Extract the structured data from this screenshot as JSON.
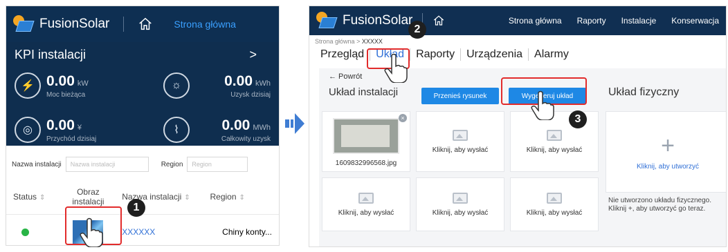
{
  "left": {
    "logo": "FusionSolar",
    "home_link": "Strona główna",
    "kpi_title": "KPI instalacji",
    "kpi_chevron": ">",
    "kpis": [
      {
        "value": "0.00",
        "unit": "kW",
        "label": "Moc bieżąca",
        "icon": "lightning-icon"
      },
      {
        "value": "0.00",
        "unit": "kWh",
        "label": "Uzysk dzisiaj",
        "icon": "sun-gear-icon"
      },
      {
        "value": "0.00",
        "unit": "¥",
        "label": "Przychód dzisiaj",
        "icon": "coins-icon"
      },
      {
        "value": "0.00",
        "unit": "MWh",
        "label": "Całkowity uzysk",
        "icon": "chart-icon"
      }
    ],
    "filter": {
      "name_label": "Nazwa instalacji",
      "name_placeholder": "Nazwa instalacji",
      "region_label": "Region",
      "region_placeholder": "Region"
    },
    "table": {
      "headers": [
        "Status",
        "Obraz instalacji",
        "Nazwa instalacji",
        "Region"
      ],
      "row": {
        "name": "XXXXXX",
        "region": "Chiny konty..."
      }
    }
  },
  "right": {
    "logo": "FusionSolar",
    "nav": [
      "Strona główna",
      "Raporty",
      "Instalacje",
      "Konserwacja"
    ],
    "breadcrumb": {
      "home": "Strona główna",
      "sep": ">",
      "current": "XXXXX"
    },
    "tabs": [
      "Przegląd",
      "Układ",
      "Raporty",
      "Urządzenia",
      "Alarmy"
    ],
    "back": "← Powrót",
    "section_title": "Układ instalacji",
    "buttons": {
      "move": "Przenieś rysunek",
      "generate": "Wygeneruj układ"
    },
    "physical_title": "Układ fizyczny",
    "uploaded_file": "1609832996568.jpg",
    "upload_label": "Kliknij, aby wysłać",
    "create_label": "Kliknij, aby utworzyć",
    "note_line1": "Nie utworzono układu fizycznego.",
    "note_line2": "Kliknij +, aby utworzyć go teraz."
  },
  "steps": [
    "1",
    "2",
    "3"
  ],
  "colors": {
    "navy": "#0f2e4f",
    "accent": "#1e88e5",
    "highlight": "#e22b2b",
    "online": "#28b446"
  }
}
